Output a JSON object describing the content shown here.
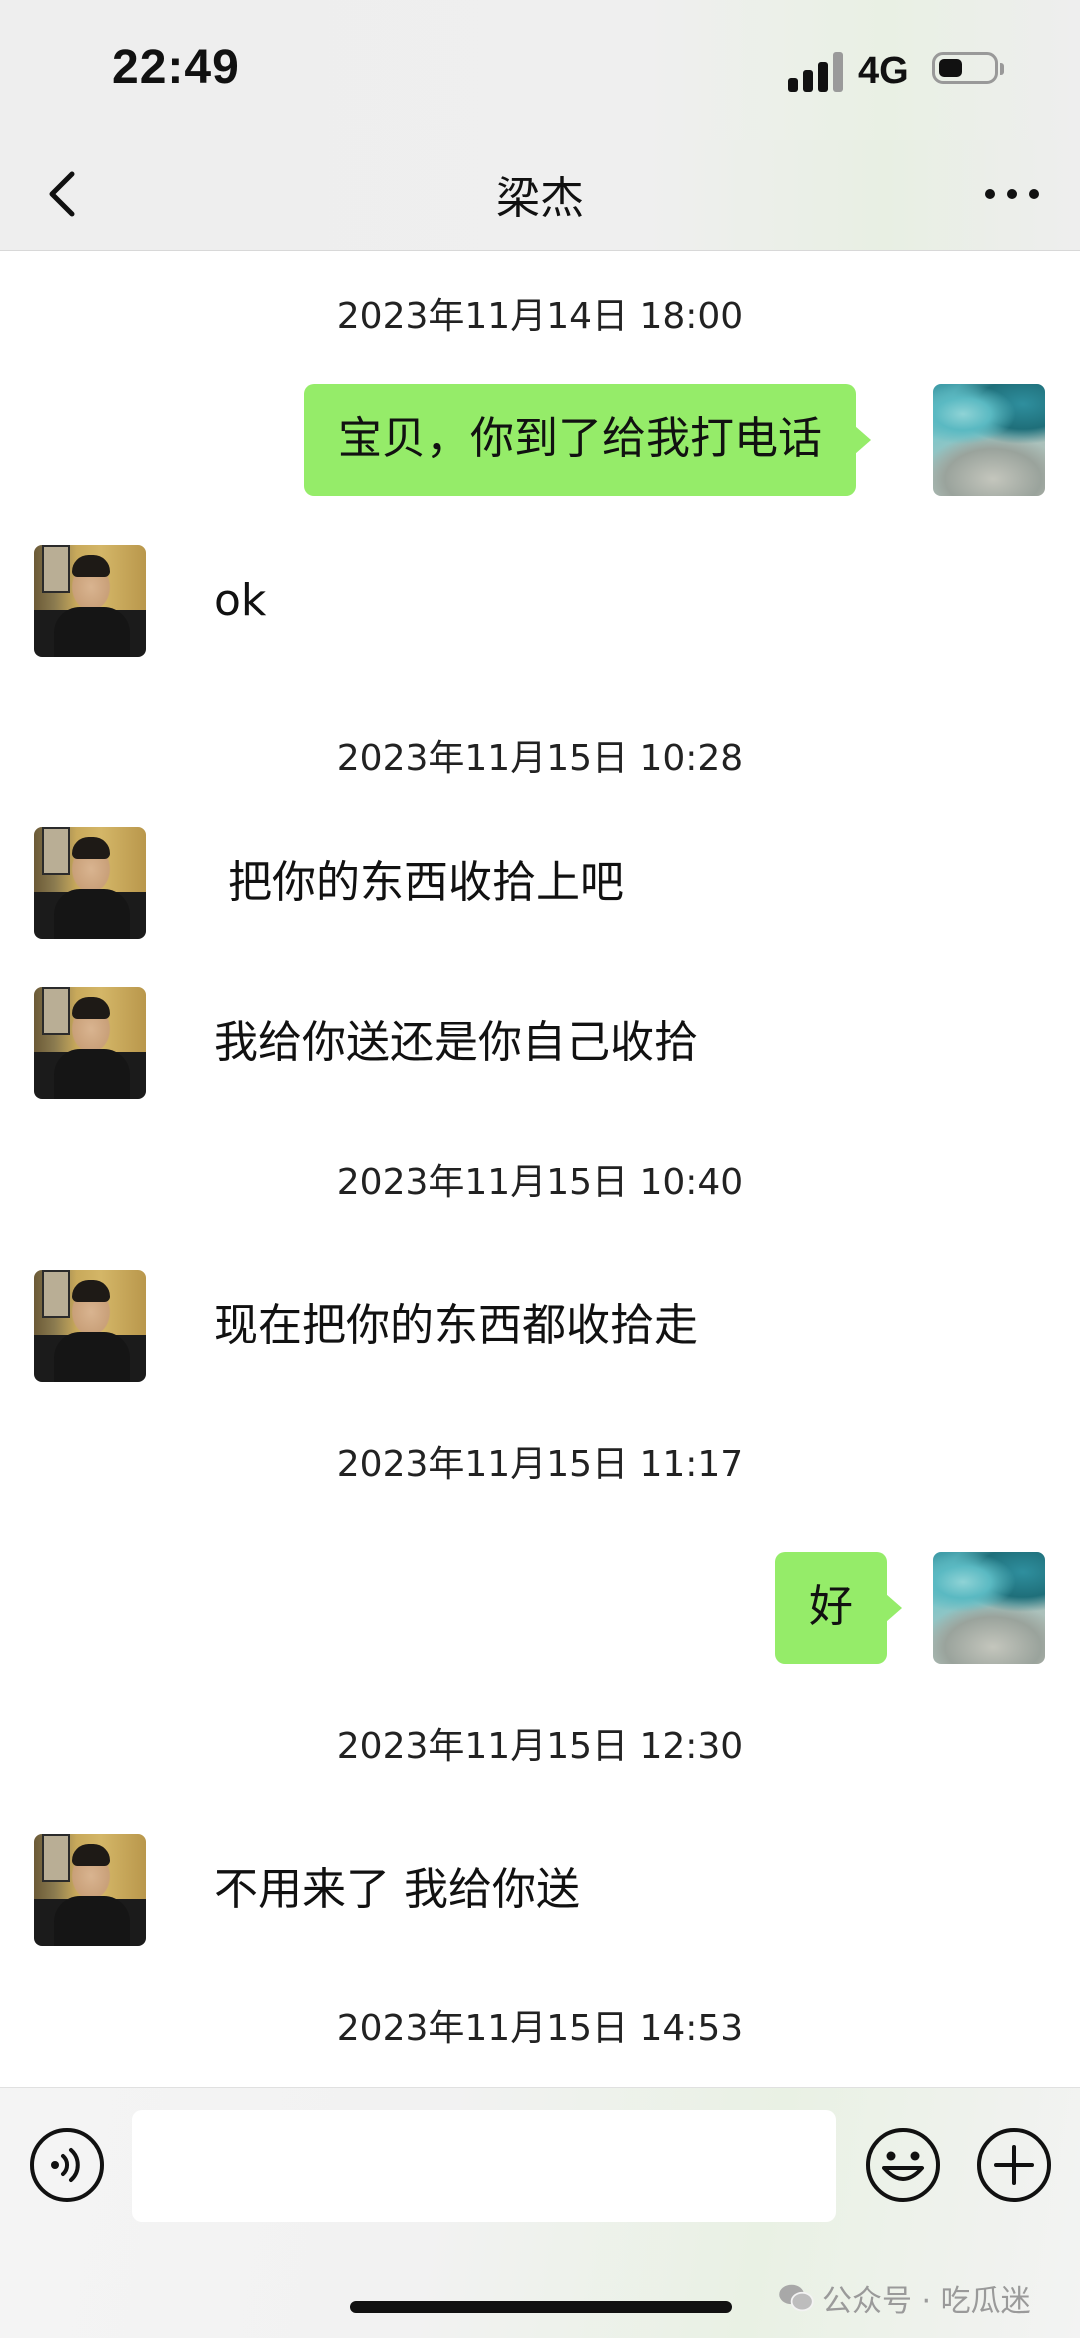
{
  "status_bar": {
    "time": "22:49",
    "network": "4G",
    "battery_level": 0.45
  },
  "header": {
    "title": "梁杰",
    "back_icon": "chevron-left-icon",
    "more_icon": "more-dots-icon"
  },
  "messages": [
    {
      "type": "timestamp",
      "text": "2023年11月14日 18:00"
    },
    {
      "type": "sent",
      "text": "宝贝，你到了给我打电话"
    },
    {
      "type": "received",
      "text": "ok"
    },
    {
      "type": "timestamp",
      "text": "2023年11月15日 10:28"
    },
    {
      "type": "received",
      "text": " 把你的东西收拾上吧"
    },
    {
      "type": "received",
      "text": "我给你送还是你自己收拾"
    },
    {
      "type": "timestamp",
      "text": "2023年11月15日 10:40"
    },
    {
      "type": "received",
      "text": "现在把你的东西都收拾走"
    },
    {
      "type": "timestamp",
      "text": "2023年11月15日 11:17"
    },
    {
      "type": "sent",
      "text": "好"
    },
    {
      "type": "timestamp",
      "text": "2023年11月15日 12:30"
    },
    {
      "type": "received",
      "text": "不用来了 我给你送"
    },
    {
      "type": "timestamp",
      "text": "2023年11月15日 14:53"
    }
  ],
  "input_bar": {
    "voice_icon": "voice-icon",
    "emoji_icon": "emoji-icon",
    "plus_icon": "plus-icon",
    "input_value": ""
  },
  "watermark": {
    "text": "公众号 · 吃瓜迷",
    "icon": "wechat-logo-icon"
  }
}
